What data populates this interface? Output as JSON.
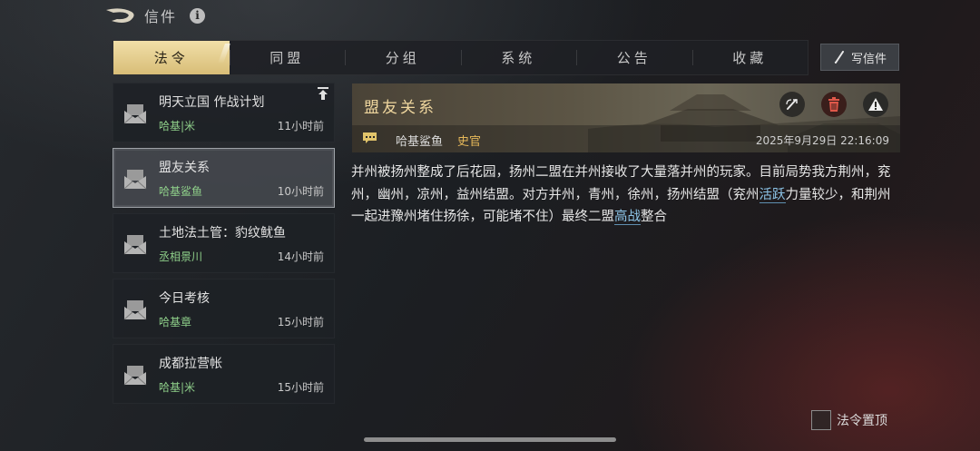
{
  "header": {
    "title": "信件",
    "info_icon": "info-icon",
    "info_glyph": "i"
  },
  "tabs": [
    {
      "label": "法令",
      "active": true
    },
    {
      "label": "同盟",
      "active": false
    },
    {
      "label": "分组",
      "active": false
    },
    {
      "label": "系统",
      "active": false
    },
    {
      "label": "公告",
      "active": false
    },
    {
      "label": "收藏",
      "active": false
    }
  ],
  "write_button": {
    "label": "写信件",
    "icon": "pen-icon"
  },
  "mails": [
    {
      "subject": "明天立国 作战计划",
      "sender": "哈基|米",
      "time": "11小时前",
      "pinned": true,
      "selected": false
    },
    {
      "subject": "盟友关系",
      "sender": "哈基鲨鱼",
      "time": "10小时前",
      "pinned": false,
      "selected": true
    },
    {
      "subject": "土地法土管：豹纹鱿鱼",
      "sender": "丞相景川",
      "time": "14小时前",
      "pinned": false,
      "selected": false
    },
    {
      "subject": "今日考核",
      "sender": "哈基章",
      "time": "15小时前",
      "pinned": false,
      "selected": false
    },
    {
      "subject": "成都拉营帐",
      "sender": "哈基|米",
      "time": "15小时前",
      "pinned": false,
      "selected": false
    }
  ],
  "detail": {
    "title": "盟友关系",
    "sender": "哈基鲨鱼",
    "role": "史官",
    "date": "2025年9月29日 22:16:09",
    "actions": [
      "reply-icon",
      "delete-icon",
      "report-icon"
    ],
    "body": {
      "part1": "并州被扬州整成了后花园，扬州二盟在并州接收了大量落并州的玩家。目前局势我方荆州，兖州，幽州，凉州，益州结盟。对方并州，青州，徐州，扬州结盟（兖州",
      "term1": "活跃",
      "part2": "力量较少，和荆州一起进豫州堵住扬徐，可能堵不住）最终二盟",
      "term2": "高战",
      "part3": "整合"
    }
  },
  "pin_toggle": {
    "label": "法令置顶",
    "checked": false
  },
  "colors": {
    "accent_gold": "#e6cf90",
    "sender_green": "#8fd08a",
    "role_orange": "#e6b85a",
    "link_blue": "#8cc3e6"
  }
}
